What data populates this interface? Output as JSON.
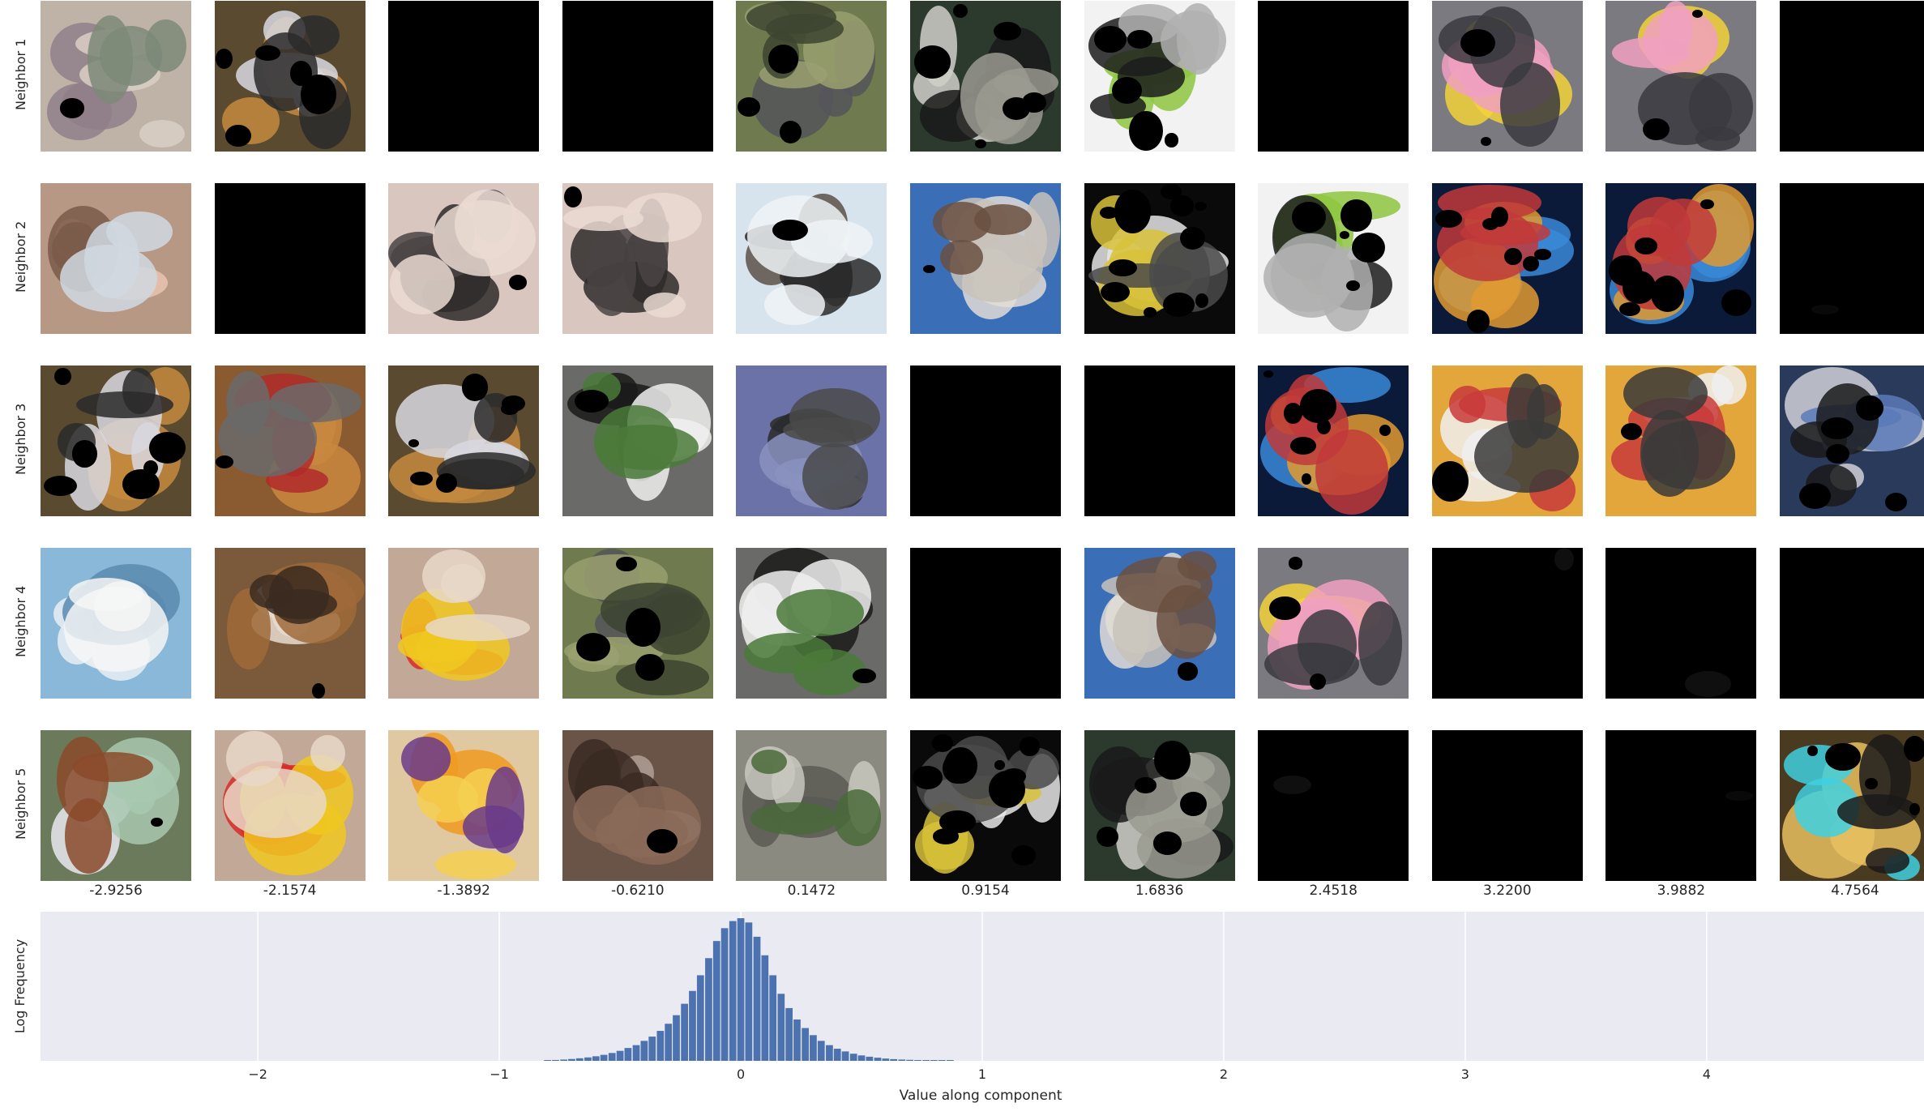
{
  "rows": [
    {
      "label": "Neighbor 1"
    },
    {
      "label": "Neighbor 2"
    },
    {
      "label": "Neighbor 3"
    },
    {
      "label": "Neighbor 4"
    },
    {
      "label": "Neighbor 5"
    }
  ],
  "column_values": [
    "-2.9256",
    "-2.1574",
    "-1.3892",
    "-0.6210",
    "0.1472",
    "0.9154",
    "1.6836",
    "2.4518",
    "3.2200",
    "3.9882",
    "4.7564"
  ],
  "thumbnails": [
    [
      {
        "subject": "knitted teddy bear",
        "bg": "#bfb2a6",
        "accents": [
          "#8f7f8a",
          "#d9cfc4",
          "#7d8a78"
        ],
        "dark_fraction": 0.05
      },
      {
        "subject": "golden retrievers on bed",
        "bg": "#5a4a30",
        "accents": [
          "#c48a3e",
          "#d8d8e0",
          "#2a2a2a"
        ],
        "dark_fraction": 0.35
      },
      {
        "subject": "black patch",
        "bg": "#000000",
        "accents": [],
        "dark_fraction": 1
      },
      {
        "subject": "black patch",
        "bg": "#000000",
        "accents": [],
        "dark_fraction": 1
      },
      {
        "subject": "dog in grass",
        "bg": "#6f7a4e",
        "accents": [
          "#55555a",
          "#9aa070",
          "#3d4430"
        ],
        "dark_fraction": 0.15
      },
      {
        "subject": "computer monitor",
        "bg": "#2c3a2e",
        "accents": [
          "#cfcfc8",
          "#1a1a1a",
          "#9a9a90"
        ],
        "dark_fraction": 0.35
      },
      {
        "subject": "phones on white",
        "bg": "#f2f2f2",
        "accents": [
          "#8ec63f",
          "#1c1c1c",
          "#b0b0b0"
        ],
        "dark_fraction": 0.3
      },
      {
        "subject": "black patch",
        "bg": "#000000",
        "accents": [],
        "dark_fraction": 1
      },
      {
        "subject": "pikachu toys on keyboard",
        "bg": "#7a7a80",
        "accents": [
          "#f2d23a",
          "#f0a0c0",
          "#3a3a40"
        ],
        "dark_fraction": 0.1
      },
      {
        "subject": "pikachu toys on keyboard",
        "bg": "#7a7a80",
        "accents": [
          "#f2d23a",
          "#f0a0c0",
          "#3a3a40"
        ],
        "dark_fraction": 0.1
      },
      {
        "subject": "black patch",
        "bg": "#000000",
        "accents": [],
        "dark_fraction": 1
      }
    ],
    [
      {
        "subject": "screaming face",
        "bg": "#b79885",
        "accents": [
          "#e8c4b0",
          "#7a5a4a",
          "#d0d8e0"
        ],
        "dark_fraction": 0.02
      },
      {
        "subject": "black patch",
        "bg": "#000000",
        "accents": [],
        "dark_fraction": 1
      },
      {
        "subject": "black furry animal",
        "bg": "#d9c7bf",
        "accents": [
          "#2e2a2a",
          "#4a4444",
          "#eadad2"
        ],
        "dark_fraction": 0.05
      },
      {
        "subject": "black furry animal",
        "bg": "#d9c7bf",
        "accents": [
          "#2e2a2a",
          "#4a4444",
          "#eadad2"
        ],
        "dark_fraction": 0.05
      },
      {
        "subject": "pelicans in sky",
        "bg": "#d7e4ee",
        "accents": [
          "#5a5048",
          "#2a2a2a",
          "#eef3f6"
        ],
        "dark_fraction": 0.05
      },
      {
        "subject": "white church",
        "bg": "#3a6fb8",
        "accents": [
          "#e2ddd6",
          "#c8c2ba",
          "#6a5040"
        ],
        "dark_fraction": 0.05
      },
      {
        "subject": "keyboard shelf dark",
        "bg": "#0a0a0a",
        "accents": [
          "#e6e6e6",
          "#d8c23a",
          "#4a4a4a"
        ],
        "dark_fraction": 0.6
      },
      {
        "subject": "phones on white",
        "bg": "#f2f2f2",
        "accents": [
          "#8ec63f",
          "#1c1c1c",
          "#b0b0b0"
        ],
        "dark_fraction": 0.3
      },
      {
        "subject": "computer screens",
        "bg": "#0c1a3a",
        "accents": [
          "#3a8ad8",
          "#e09a30",
          "#c03a3a"
        ],
        "dark_fraction": 0.4
      },
      {
        "subject": "computer screens",
        "bg": "#0c1a3a",
        "accents": [
          "#3a8ad8",
          "#e09a30",
          "#c03a3a"
        ],
        "dark_fraction": 0.4
      },
      {
        "subject": "black patch",
        "bg": "#000000",
        "accents": [
          "#1a1a1a"
        ],
        "dark_fraction": 1
      }
    ],
    [
      {
        "subject": "golden retrievers on bed",
        "bg": "#5a4a30",
        "accents": [
          "#c48a3e",
          "#d8d8e0",
          "#2a2a2a"
        ],
        "dark_fraction": 0.35
      },
      {
        "subject": "dog with hat",
        "bg": "#8a5a30",
        "accents": [
          "#c8883e",
          "#b02a2a",
          "#6a6a6a"
        ],
        "dark_fraction": 0.05
      },
      {
        "subject": "golden retrievers on bed",
        "bg": "#5a4a30",
        "accents": [
          "#c48a3e",
          "#d8d8e0",
          "#2a2a2a"
        ],
        "dark_fraction": 0.35
      },
      {
        "subject": "border collie puppy",
        "bg": "#6a6a68",
        "accents": [
          "#1a1a1a",
          "#f0f0f0",
          "#4a7a3a"
        ],
        "dark_fraction": 0.05
      },
      {
        "subject": "rifle on blue",
        "bg": "#6a72a8",
        "accents": [
          "#2a2a2a",
          "#8a92c0",
          "#4a4a4a"
        ],
        "dark_fraction": 0.02
      },
      {
        "subject": "black patch",
        "bg": "#000000",
        "accents": [],
        "dark_fraction": 1
      },
      {
        "subject": "black patch",
        "bg": "#000000",
        "accents": [],
        "dark_fraction": 1
      },
      {
        "subject": "computer screens",
        "bg": "#0c1a3a",
        "accents": [
          "#3a8ad8",
          "#e09a30",
          "#c03a3a"
        ],
        "dark_fraction": 0.4
      },
      {
        "subject": "monitor with photos",
        "bg": "#e2a63a",
        "accents": [
          "#f0f0f0",
          "#c83a3a",
          "#3a3a3a"
        ],
        "dark_fraction": 0.05
      },
      {
        "subject": "monitor with photos",
        "bg": "#e2a63a",
        "accents": [
          "#f0f0f0",
          "#c83a3a",
          "#3a3a3a"
        ],
        "dark_fraction": 0.05
      },
      {
        "subject": "laptop",
        "bg": "#2a3a5a",
        "accents": [
          "#d0d0d8",
          "#5a7ab8",
          "#1a1a1a"
        ],
        "dark_fraction": 0.3
      }
    ],
    [
      {
        "subject": "blue egg box",
        "bg": "#8ab8d8",
        "accents": [
          "#e8eef4",
          "#5a8ab0",
          "#f6f6f6"
        ],
        "dark_fraction": 0.02
      },
      {
        "subject": "dog being petted",
        "bg": "#7a5a3a",
        "accents": [
          "#e8dcd0",
          "#a06a3a",
          "#3a2a20"
        ],
        "dark_fraction": 0.05
      },
      {
        "subject": "red watering can",
        "bg": "#c2a896",
        "accents": [
          "#d82a2a",
          "#f0c820",
          "#e8d8c8"
        ],
        "dark_fraction": 0.02
      },
      {
        "subject": "dog in grass",
        "bg": "#6f7a4e",
        "accents": [
          "#55555a",
          "#9aa070",
          "#3d4430"
        ],
        "dark_fraction": 0.2
      },
      {
        "subject": "border collie puppy",
        "bg": "#6a6a68",
        "accents": [
          "#1a1a1a",
          "#f0f0f0",
          "#4a7a3a"
        ],
        "dark_fraction": 0.05
      },
      {
        "subject": "black patch",
        "bg": "#000000",
        "accents": [],
        "dark_fraction": 1
      },
      {
        "subject": "white church",
        "bg": "#3a6fb8",
        "accents": [
          "#e2ddd6",
          "#c8c2ba",
          "#6a5040"
        ],
        "dark_fraction": 0.05
      },
      {
        "subject": "pikachu toys on keyboard",
        "bg": "#7a7a80",
        "accents": [
          "#f2d23a",
          "#f0a0c0",
          "#3a3a40"
        ],
        "dark_fraction": 0.15
      },
      {
        "subject": "black patch",
        "bg": "#000000",
        "accents": [
          "#2a2a2a"
        ],
        "dark_fraction": 1
      },
      {
        "subject": "black patch",
        "bg": "#000000",
        "accents": [
          "#2a2a2a"
        ],
        "dark_fraction": 1
      },
      {
        "subject": "black patch",
        "bg": "#000000",
        "accents": [],
        "dark_fraction": 1
      }
    ],
    [
      {
        "subject": "flowers in vase",
        "bg": "#6a7a5a",
        "accents": [
          "#e8e8f0",
          "#a8c8b0",
          "#8a4a2a"
        ],
        "dark_fraction": 0.05
      },
      {
        "subject": "red watering can",
        "bg": "#c2a896",
        "accents": [
          "#d82a2a",
          "#f0c820",
          "#e8d8c8"
        ],
        "dark_fraction": 0.02
      },
      {
        "subject": "oranges and containers",
        "bg": "#e0c8a0",
        "accents": [
          "#f09a20",
          "#f4d050",
          "#6a3a8a"
        ],
        "dark_fraction": 0.02
      },
      {
        "subject": "basset hound",
        "bg": "#6a5448",
        "accents": [
          "#b0a098",
          "#3a2a22",
          "#8a6a58"
        ],
        "dark_fraction": 0.05
      },
      {
        "subject": "elephant and people",
        "bg": "#8a8a80",
        "accents": [
          "#5a5a55",
          "#c8c8c0",
          "#4a6a3a"
        ],
        "dark_fraction": 0.02
      },
      {
        "subject": "keyboard shelf dark",
        "bg": "#0a0a0a",
        "accents": [
          "#e6e6e6",
          "#d8c23a",
          "#4a4a4a"
        ],
        "dark_fraction": 0.6
      },
      {
        "subject": "computer monitor",
        "bg": "#2c3a2e",
        "accents": [
          "#cfcfc8",
          "#1a1a1a",
          "#9a9a90"
        ],
        "dark_fraction": 0.3
      },
      {
        "subject": "black patch",
        "bg": "#000000",
        "accents": [
          "#2a2a2a"
        ],
        "dark_fraction": 1
      },
      {
        "subject": "black patch",
        "bg": "#000000",
        "accents": [],
        "dark_fraction": 1
      },
      {
        "subject": "black patch",
        "bg": "#000000",
        "accents": [
          "#1a1a1a"
        ],
        "dark_fraction": 1
      },
      {
        "subject": "train interior",
        "bg": "#4a3a20",
        "accents": [
          "#e8c060",
          "#40d0e0",
          "#1a1a1a"
        ],
        "dark_fraction": 0.3
      }
    ]
  ],
  "chart_data": {
    "type": "bar",
    "xlabel": "Value along component",
    "ylabel": "Log Frequency",
    "xlim": [
      -2.9,
      4.9
    ],
    "xticks": [
      -2,
      -1,
      0,
      1,
      2,
      3,
      4
    ],
    "xtick_labels": [
      "−2",
      "−1",
      "0",
      "1",
      "2",
      "3",
      "4"
    ],
    "grid": true,
    "background": "#eaeaf2",
    "bar_color": "#4c72b0",
    "bin_width": 0.0333,
    "x": [
      -0.8,
      -0.767,
      -0.733,
      -0.7,
      -0.667,
      -0.633,
      -0.6,
      -0.567,
      -0.533,
      -0.5,
      -0.467,
      -0.433,
      -0.4,
      -0.367,
      -0.333,
      -0.3,
      -0.267,
      -0.233,
      -0.2,
      -0.167,
      -0.133,
      -0.1,
      -0.067,
      -0.033,
      0.0,
      0.033,
      0.067,
      0.1,
      0.133,
      0.167,
      0.2,
      0.233,
      0.267,
      0.3,
      0.333,
      0.367,
      0.4,
      0.433,
      0.467,
      0.5,
      0.533,
      0.567,
      0.6,
      0.633,
      0.667,
      0.7,
      0.733,
      0.767,
      0.8,
      0.833,
      0.867
    ],
    "values": [
      0.004,
      0.006,
      0.009,
      0.013,
      0.018,
      0.024,
      0.032,
      0.042,
      0.055,
      0.07,
      0.09,
      0.11,
      0.14,
      0.17,
      0.21,
      0.26,
      0.32,
      0.4,
      0.49,
      0.6,
      0.72,
      0.84,
      0.93,
      0.98,
      1.0,
      0.97,
      0.87,
      0.74,
      0.6,
      0.47,
      0.37,
      0.29,
      0.23,
      0.18,
      0.14,
      0.11,
      0.085,
      0.066,
      0.05,
      0.038,
      0.029,
      0.022,
      0.016,
      0.012,
      0.009,
      0.007,
      0.005,
      0.004,
      0.003,
      0.002,
      0.001
    ]
  }
}
